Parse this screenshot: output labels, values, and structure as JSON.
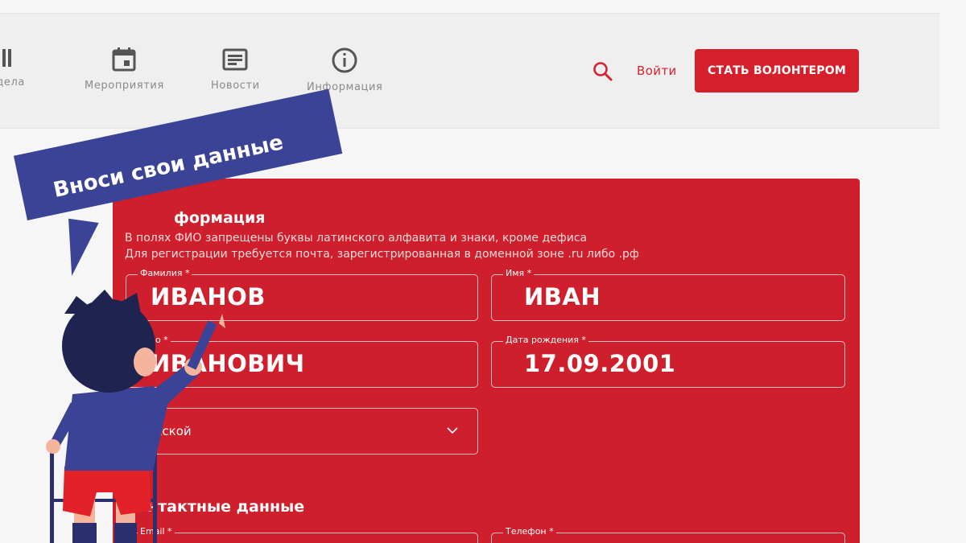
{
  "nav": {
    "items": [
      {
        "label": "е дела",
        "icon": "bars-icon"
      },
      {
        "label": "Мероприятия",
        "icon": "calendar-icon"
      },
      {
        "label": "Новости",
        "icon": "news-icon"
      },
      {
        "label": "Информация",
        "icon": "info-icon"
      }
    ],
    "login": "Войти",
    "cta": "СТАТЬ ВОЛОНТЕРОМ"
  },
  "banner": {
    "text": "Вноси свои данные"
  },
  "form": {
    "personal_title": "формация",
    "notes": [
      "В полях ФИО запрещены буквы латинского алфавита и знаки, кроме дефиса",
      "Для регистрации требуется почта, зарегистрированная в доменной зоне .ru либо .рф"
    ],
    "fields": {
      "surname": {
        "label": "Фамилия *",
        "value": "ИВАНОВ"
      },
      "name": {
        "label": "Имя *",
        "value": "ИВАН"
      },
      "patronymic": {
        "label": "ство *",
        "value": "ИВАНОВИЧ"
      },
      "birthdate": {
        "label": "Дата рождения *",
        "value": "17.09.2001"
      },
      "gender": {
        "value": "ужской"
      },
      "email": {
        "label": "Email *"
      },
      "phone": {
        "label": "Телефон *"
      }
    },
    "contacts_title": "нтактные данные"
  },
  "colors": {
    "brand_red": "#d5202c",
    "card_red": "#cf1f2c",
    "banner_blue": "#3b4396"
  }
}
